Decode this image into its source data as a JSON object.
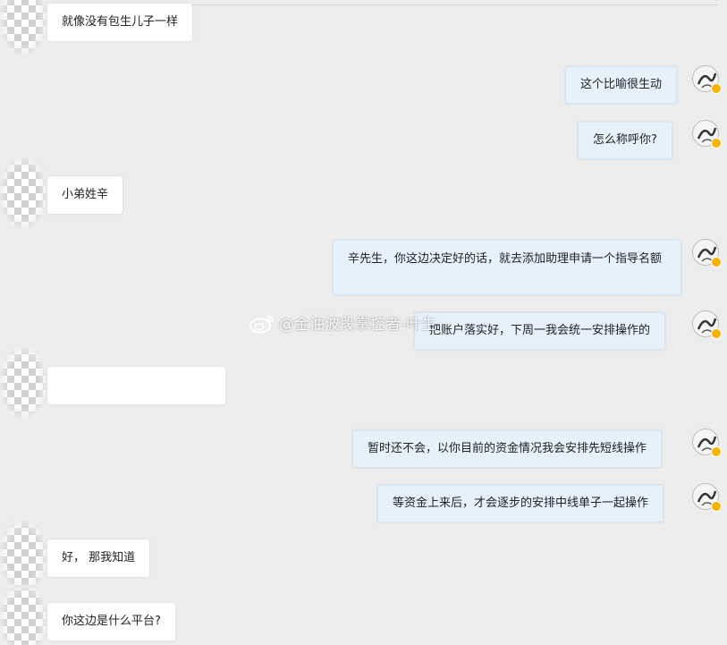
{
  "conversation": {
    "messages": [
      {
        "side": "left",
        "text": "就像没有包生儿子一样"
      },
      {
        "side": "right",
        "text": "这个比喻很生动"
      },
      {
        "side": "right",
        "text": "怎么称呼你?"
      },
      {
        "side": "left",
        "text": "小弟姓辛"
      },
      {
        "side": "right",
        "text": "辛先生，你这边决定好的话，就去添加助理申请一个指导名额"
      },
      {
        "side": "right",
        "text": "把账户落实好，下周一我会统一安排操作的"
      },
      {
        "side": "left",
        "text": "",
        "note": "redacted"
      },
      {
        "side": "right",
        "text": "暂时还不会，以你目前的资金情况我会安排先短线操作"
      },
      {
        "side": "right",
        "text": "等资金上来后，才会逐步的安排中线单子一起操作"
      },
      {
        "side": "left",
        "text": "好， 那我知道"
      },
      {
        "side": "left",
        "text": "你这边是什么平台?"
      }
    ]
  },
  "watermark": {
    "text": "@金油波段掌控者-叶生",
    "icon": "weibo-icon"
  },
  "colors": {
    "background": "#ededed",
    "left_bubble": "#ffffff",
    "right_bubble": "#e6f1fb",
    "badge": "#f5b400"
  }
}
